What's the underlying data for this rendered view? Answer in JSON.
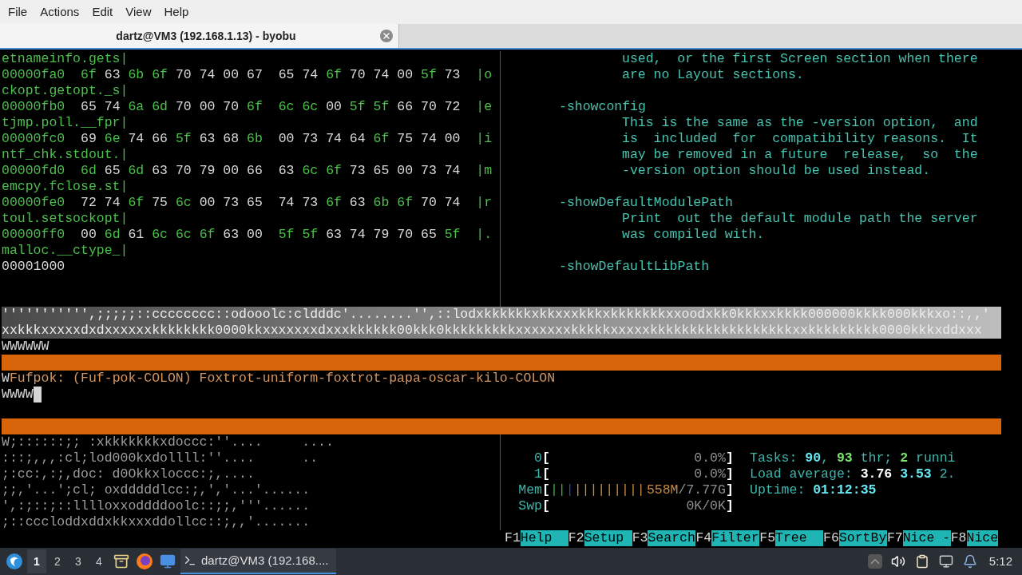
{
  "menu": [
    "File",
    "Actions",
    "Edit",
    "View",
    "Help"
  ],
  "tabs": [
    {
      "title": "dartz@VM3 (192.168.1.13) - byobu",
      "selected": true
    }
  ],
  "hexdump": [
    {
      "kind": "wrap",
      "text": "etnameinfo.gets|"
    },
    {
      "kind": "hex",
      "offset": "00000fa0",
      "bytes": [
        {
          "v": "6f",
          "highlighted": true
        },
        {
          "v": "63",
          "highlighted": false
        },
        {
          "v": "6b",
          "highlighted": true
        },
        {
          "v": "6f",
          "highlighted": true
        },
        {
          "v": "70",
          "highlighted": false
        },
        {
          "v": "74",
          "highlighted": false
        },
        {
          "v": "00",
          "highlighted": false
        },
        {
          "v": "67",
          "highlighted": false
        },
        {
          "v": "65",
          "highlighted": false
        },
        {
          "v": "74",
          "highlighted": false
        },
        {
          "v": "6f",
          "highlighted": true
        },
        {
          "v": "70",
          "highlighted": false
        },
        {
          "v": "74",
          "highlighted": false
        },
        {
          "v": "00",
          "highlighted": false
        },
        {
          "v": "5f",
          "highlighted": true
        },
        {
          "v": "73",
          "highlighted": false
        }
      ],
      "ascii": "|o"
    },
    {
      "kind": "wrap",
      "text": "ckopt.getopt._s|"
    },
    {
      "kind": "hex",
      "offset": "00000fb0",
      "bytes": [
        {
          "v": "65",
          "highlighted": false
        },
        {
          "v": "74",
          "highlighted": false
        },
        {
          "v": "6a",
          "highlighted": true
        },
        {
          "v": "6d",
          "highlighted": true
        },
        {
          "v": "70",
          "highlighted": false
        },
        {
          "v": "00",
          "highlighted": false
        },
        {
          "v": "70",
          "highlighted": false
        },
        {
          "v": "6f",
          "highlighted": true
        },
        {
          "v": "6c",
          "highlighted": true
        },
        {
          "v": "6c",
          "highlighted": true
        },
        {
          "v": "00",
          "highlighted": false
        },
        {
          "v": "5f",
          "highlighted": true
        },
        {
          "v": "5f",
          "highlighted": true
        },
        {
          "v": "66",
          "highlighted": false
        },
        {
          "v": "70",
          "highlighted": false
        },
        {
          "v": "72",
          "highlighted": false
        }
      ],
      "ascii": "|e"
    },
    {
      "kind": "wrap",
      "text": "tjmp.poll.__fpr|"
    },
    {
      "kind": "hex",
      "offset": "00000fc0",
      "bytes": [
        {
          "v": "69",
          "highlighted": false
        },
        {
          "v": "6e",
          "highlighted": true
        },
        {
          "v": "74",
          "highlighted": false
        },
        {
          "v": "66",
          "highlighted": false
        },
        {
          "v": "5f",
          "highlighted": true
        },
        {
          "v": "63",
          "highlighted": false
        },
        {
          "v": "68",
          "highlighted": false
        },
        {
          "v": "6b",
          "highlighted": true
        },
        {
          "v": "00",
          "highlighted": false
        },
        {
          "v": "73",
          "highlighted": false
        },
        {
          "v": "74",
          "highlighted": false
        },
        {
          "v": "64",
          "highlighted": false
        },
        {
          "v": "6f",
          "highlighted": true
        },
        {
          "v": "75",
          "highlighted": false
        },
        {
          "v": "74",
          "highlighted": false
        },
        {
          "v": "00",
          "highlighted": false
        }
      ],
      "ascii": "|i"
    },
    {
      "kind": "wrap",
      "text": "ntf_chk.stdout.|"
    },
    {
      "kind": "hex",
      "offset": "00000fd0",
      "bytes": [
        {
          "v": "6d",
          "highlighted": true
        },
        {
          "v": "65",
          "highlighted": false
        },
        {
          "v": "6d",
          "highlighted": true
        },
        {
          "v": "63",
          "highlighted": false
        },
        {
          "v": "70",
          "highlighted": false
        },
        {
          "v": "79",
          "highlighted": false
        },
        {
          "v": "00",
          "highlighted": false
        },
        {
          "v": "66",
          "highlighted": false
        },
        {
          "v": "63",
          "highlighted": false
        },
        {
          "v": "6c",
          "highlighted": true
        },
        {
          "v": "6f",
          "highlighted": true
        },
        {
          "v": "73",
          "highlighted": false
        },
        {
          "v": "65",
          "highlighted": false
        },
        {
          "v": "00",
          "highlighted": false
        },
        {
          "v": "73",
          "highlighted": false
        },
        {
          "v": "74",
          "highlighted": false
        }
      ],
      "ascii": "|m"
    },
    {
      "kind": "wrap",
      "text": "emcpy.fclose.st|"
    },
    {
      "kind": "hex",
      "offset": "00000fe0",
      "bytes": [
        {
          "v": "72",
          "highlighted": false
        },
        {
          "v": "74",
          "highlighted": false
        },
        {
          "v": "6f",
          "highlighted": true
        },
        {
          "v": "75",
          "highlighted": false
        },
        {
          "v": "6c",
          "highlighted": true
        },
        {
          "v": "00",
          "highlighted": false
        },
        {
          "v": "73",
          "highlighted": false
        },
        {
          "v": "65",
          "highlighted": false
        },
        {
          "v": "74",
          "highlighted": false
        },
        {
          "v": "73",
          "highlighted": false
        },
        {
          "v": "6f",
          "highlighted": true
        },
        {
          "v": "63",
          "highlighted": false
        },
        {
          "v": "6b",
          "highlighted": true
        },
        {
          "v": "6f",
          "highlighted": true
        },
        {
          "v": "70",
          "highlighted": false
        },
        {
          "v": "74",
          "highlighted": false
        }
      ],
      "ascii": "|r"
    },
    {
      "kind": "wrap",
      "text": "toul.setsockopt|"
    },
    {
      "kind": "hex",
      "offset": "00000ff0",
      "bytes": [
        {
          "v": "00",
          "highlighted": false
        },
        {
          "v": "6d",
          "highlighted": true
        },
        {
          "v": "61",
          "highlighted": false
        },
        {
          "v": "6c",
          "highlighted": true
        },
        {
          "v": "6c",
          "highlighted": true
        },
        {
          "v": "6f",
          "highlighted": true
        },
        {
          "v": "63",
          "highlighted": false
        },
        {
          "v": "00",
          "highlighted": false
        },
        {
          "v": "5f",
          "highlighted": true
        },
        {
          "v": "5f",
          "highlighted": true
        },
        {
          "v": "63",
          "highlighted": false
        },
        {
          "v": "74",
          "highlighted": false
        },
        {
          "v": "79",
          "highlighted": false
        },
        {
          "v": "70",
          "highlighted": false
        },
        {
          "v": "65",
          "highlighted": false
        },
        {
          "v": "5f",
          "highlighted": true
        }
      ],
      "ascii": "|."
    },
    {
      "kind": "wrap",
      "text": "malloc.__ctype_|"
    },
    {
      "kind": "end",
      "text": "00001000"
    }
  ],
  "manpage": [
    {
      "kind": "body",
      "text": "used,  or the first Screen section when there"
    },
    {
      "kind": "body",
      "text": "are no Layout sections."
    },
    {
      "kind": "blank"
    },
    {
      "kind": "option",
      "text": "-showconfig"
    },
    {
      "kind": "body",
      "text": "This is the same as the -version option,  and"
    },
    {
      "kind": "body",
      "text": "is  included  for  compatibility reasons.  It"
    },
    {
      "kind": "body",
      "text": "may be removed in a future  release,  so  the"
    },
    {
      "kind": "body",
      "text": "-version option should be used instead."
    },
    {
      "kind": "blank"
    },
    {
      "kind": "option",
      "text": "-showDefaultModulePath"
    },
    {
      "kind": "body",
      "text": "Print  out the default module path the server"
    },
    {
      "kind": "body",
      "text": "was compiled with."
    },
    {
      "kind": "blank"
    },
    {
      "kind": "option",
      "text": "-showDefaultLibPath"
    }
  ],
  "console": [
    {
      "kind": "art",
      "text": "''''''''''',;;;;;::cccccccc::odooolc:cldddc'........'',::lodxkkkkkkxkkxxxkkkxkkkkkkkxxoodxkk0kkkxxkkkk000000kkkk000kkkxo::,,'"
    },
    {
      "kind": "art",
      "text": "xxkkkxxxxxdxdxxxxxxkkkkkkkk0000kkxxxxxxxdxxxkkkkkk00kkk0kkkkkkkkkxxxxxxxkkkkkxxxxxkkkkkkkkkkkkkkkkkkxxkkkkkkkkk0000kkkxddxxx"
    },
    {
      "kind": "text",
      "parts": [
        {
          "text": "WWWWWW"
        }
      ]
    },
    {
      "kind": "bar"
    },
    {
      "kind": "text",
      "parts": [
        {
          "text": "W",
          "color": "#d6d6d6"
        },
        {
          "text": "Fufpok: (Fuf-pok-COLON) Foxtrot-uniform-foxtrot-papa-oscar-kilo-COLON",
          "color": "#d4955f"
        }
      ]
    },
    {
      "kind": "input",
      "text": "WWWW",
      "cursor": true
    },
    {
      "kind": "blank"
    },
    {
      "kind": "bar"
    }
  ],
  "bottom_art": [
    "W;::::::;; :xkkkkkkkxdoccc:''....     ....",
    ":::;,,,:cl;lod000kxdollll:''....      ..",
    ";:cc:,:;,doc: d0Okkxloccc:;,....",
    ";;,'...';cl; oxdddddlcc:;,','...'......",
    "',:;::;::lllloxxoddddoolc::;;,'''......",
    ";::cccloddxddxkkxxxddollcc::;,,'......."
  ],
  "htop": {
    "meters": [
      {
        "kind": "cpu",
        "label": "0",
        "left": "[",
        "right": "]",
        "reading": "0.0%"
      },
      {
        "kind": "cpu",
        "label": "1",
        "left": "[",
        "right": "]",
        "reading": "0.0%"
      },
      {
        "kind": "mem",
        "label": "Mem",
        "left": "[",
        "right": "]",
        "segments": [
          {
            "text": "||",
            "color": "#3fae3f"
          },
          {
            "text": "|",
            "color": "#3b3bb0"
          },
          {
            "text": "|||||||||",
            "color": "#c98a3e"
          }
        ],
        "reading": "558M",
        "total": "/7.77G"
      },
      {
        "kind": "swap",
        "label": "Swp",
        "left": "[",
        "right": "]",
        "reading": "0K/0K"
      }
    ],
    "stats": [
      {
        "parts": [
          {
            "text": "Tasks: ",
            "color": "#3fb6ad",
            "bold": false
          },
          {
            "text": "90",
            "color": "#66e8f0",
            "bold": true
          },
          {
            "text": ", ",
            "color": "#3fb6ad",
            "bold": false
          },
          {
            "text": "93",
            "color": "#7be36f",
            "bold": true
          },
          {
            "text": " thr; ",
            "color": "#3fb6ad",
            "bold": false
          },
          {
            "text": "2",
            "color": "#7be36f",
            "bold": true
          },
          {
            "text": " runni",
            "color": "#3fb6ad",
            "bold": false
          }
        ]
      },
      {
        "parts": [
          {
            "text": "Load average: ",
            "color": "#3fb6ad",
            "bold": false
          },
          {
            "text": "3.76",
            "color": "#ffffff",
            "bold": true
          },
          {
            "text": " 3.53",
            "color": "#66e8f0",
            "bold": true
          },
          {
            "text": " 2.",
            "color": "#3fb6ad",
            "bold": false
          }
        ]
      },
      {
        "parts": [
          {
            "text": "Uptime: ",
            "color": "#3fb6ad",
            "bold": false
          },
          {
            "text": "01:12:35",
            "color": "#66e8f0",
            "bold": true
          }
        ]
      }
    ],
    "fkeys": [
      {
        "key": "F1",
        "label": "Help"
      },
      {
        "key": "F2",
        "label": "Setup"
      },
      {
        "key": "F3",
        "label": "Search"
      },
      {
        "key": "F4",
        "label": "Filter"
      },
      {
        "key": "F5",
        "label": "Tree"
      },
      {
        "key": "F6",
        "label": "SortBy"
      },
      {
        "key": "F7",
        "label": "Nice -"
      },
      {
        "key": "F8",
        "label": "Nice"
      }
    ]
  },
  "taskbar": {
    "workspaces": [
      {
        "label": "1",
        "selected": true
      },
      {
        "label": "2",
        "selected": false
      },
      {
        "label": "3",
        "selected": false
      },
      {
        "label": "4",
        "selected": false
      }
    ],
    "tasks": [
      {
        "title": "dartz@VM3 (192.168....",
        "selected": true
      }
    ],
    "clock": "5:12"
  }
}
